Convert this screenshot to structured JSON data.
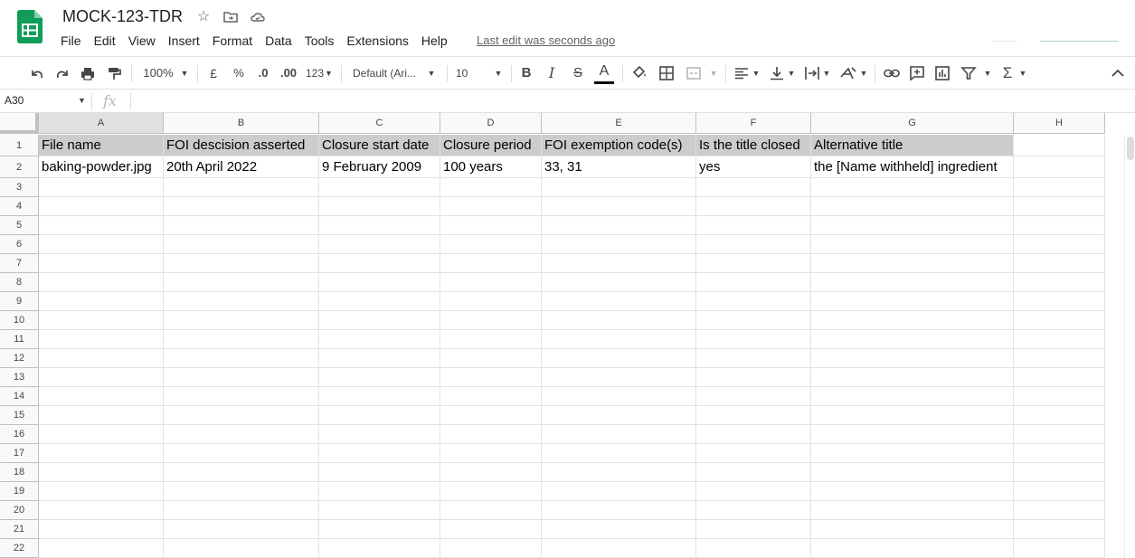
{
  "app": {
    "doc_title": "MOCK-123-TDR",
    "last_edit": "Last edit was seconds ago",
    "menu": [
      "File",
      "Edit",
      "View",
      "Insert",
      "Format",
      "Data",
      "Tools",
      "Extensions",
      "Help"
    ]
  },
  "toolbar": {
    "zoom": "100%",
    "currency": "£",
    "percent": "%",
    "decrease_decimal": ".0",
    "increase_decimal": ".00",
    "more_formats": "123",
    "font": "Default (Ari...",
    "font_size": "10",
    "bold": "B",
    "italic": "I",
    "strike": "S",
    "text_color": "A",
    "sum": "Σ",
    "icons": [
      "undo-icon",
      "redo-icon",
      "print-icon",
      "paint-format-icon",
      "fill-color-icon",
      "borders-icon",
      "merge-cells-icon",
      "align-left-icon",
      "vertical-align-icon",
      "text-wrap-icon",
      "text-rotate-icon",
      "link-icon",
      "comment-icon",
      "chart-icon",
      "filter-icon",
      "functions-icon",
      "collapse-icon"
    ]
  },
  "formula_bar": {
    "name_box": "A30",
    "fx": "fx",
    "value": ""
  },
  "sheet": {
    "columns": [
      "A",
      "B",
      "C",
      "D",
      "E",
      "F",
      "G",
      "H"
    ],
    "rows": [
      "1",
      "2",
      "3",
      "4",
      "5",
      "6",
      "7",
      "8",
      "9",
      "10",
      "11",
      "12",
      "13",
      "14",
      "15",
      "16",
      "17",
      "18",
      "19",
      "20",
      "21",
      "22"
    ],
    "header_row": [
      "File name",
      "FOI descision asserted",
      "Closure start date",
      "Closure period",
      "FOI exemption code(s)",
      "Is the title closed",
      "Alternative title",
      ""
    ],
    "data_row": [
      "baking-powder.jpg",
      "20th April 2022",
      "9 February 2009",
      "100 years",
      "33, 31",
      "yes",
      "the [Name withheld] ingredient",
      ""
    ]
  },
  "colors": {
    "logo_green": "#0f9d58",
    "header_fill": "#cccccc"
  }
}
